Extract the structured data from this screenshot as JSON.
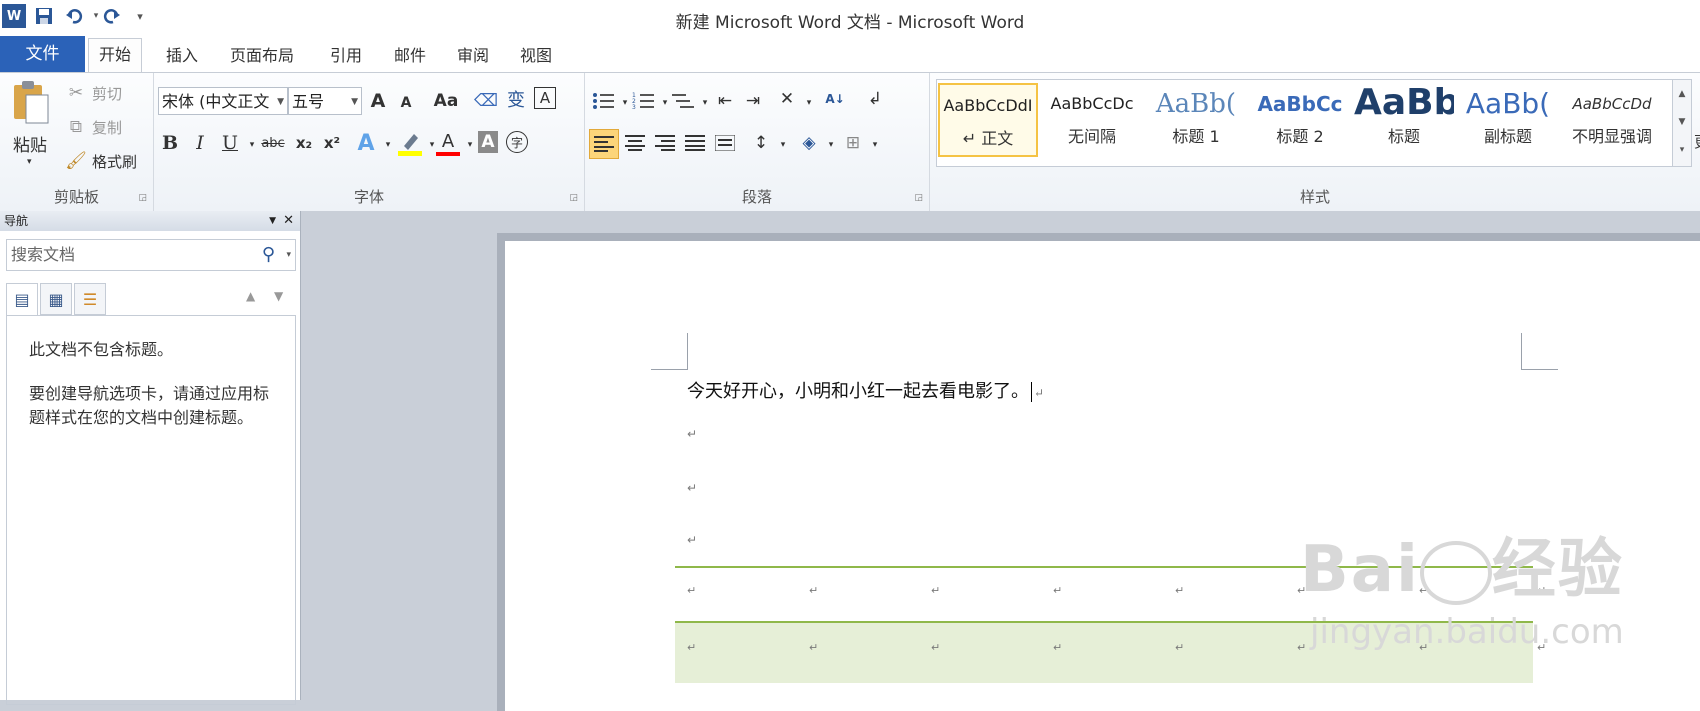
{
  "window": {
    "title": "新建 Microsoft Word 文档 - Microsoft Word"
  },
  "qat": {
    "app_icon": "W",
    "save_icon": "save-icon",
    "undo_icon": "undo-icon",
    "redo_icon": "redo-icon",
    "customize": "▾"
  },
  "tabs": {
    "file": "文件",
    "items": [
      "开始",
      "插入",
      "页面布局",
      "引用",
      "邮件",
      "审阅",
      "视图"
    ]
  },
  "ribbon": {
    "clipboard": {
      "label": "剪贴板",
      "paste": "粘贴",
      "cut": "剪切",
      "copy": "复制",
      "format_painter": "格式刷"
    },
    "font": {
      "label": "字体",
      "font_name": "宋体 (中文正文",
      "font_size": "五号",
      "bold": "B",
      "italic": "I",
      "underline": "U",
      "strike": "abc",
      "sub": "x₂",
      "sup": "x²",
      "font_color_letter": "A",
      "char_border": "A",
      "enclose": "字",
      "pinyin": "wén",
      "grow": "A",
      "shrink": "A",
      "change_case": "Aa",
      "pinyin_char": "变"
    },
    "paragraph": {
      "label": "段落"
    },
    "styles": {
      "label": "样式",
      "items": [
        {
          "sample": "AaBbCcDdI",
          "name": "↵ 正文"
        },
        {
          "sample": "AaBbCcDc",
          "name": "无间隔"
        },
        {
          "sample": "AaBb(",
          "name": "标题 1"
        },
        {
          "sample": "AaBbCc",
          "name": "标题 2"
        },
        {
          "sample": "AaBb",
          "name": "标题"
        },
        {
          "sample": "AaBb(",
          "name": "副标题"
        },
        {
          "sample": "AaBbCcDd",
          "name": "不明显强调"
        }
      ],
      "more_label": "更"
    }
  },
  "nav": {
    "title": "导航",
    "search_placeholder": "搜索文档",
    "message1": "此文档不包含标题。",
    "message2": "要创建导航选项卡，请通过应用标题样式在您的文档中创建标题。"
  },
  "document": {
    "line1": "今天好开心，小明和小红一起去看电影了。",
    "para_mark": "↵"
  },
  "watermark": {
    "text1": "Bai 经验",
    "text2": "jingyan.baidu.com"
  },
  "colors": {
    "file_tab": "#2b62b8",
    "table_line": "#8fb84a",
    "table_shade": "#e6efd7",
    "style_selected": "#f5c344"
  }
}
